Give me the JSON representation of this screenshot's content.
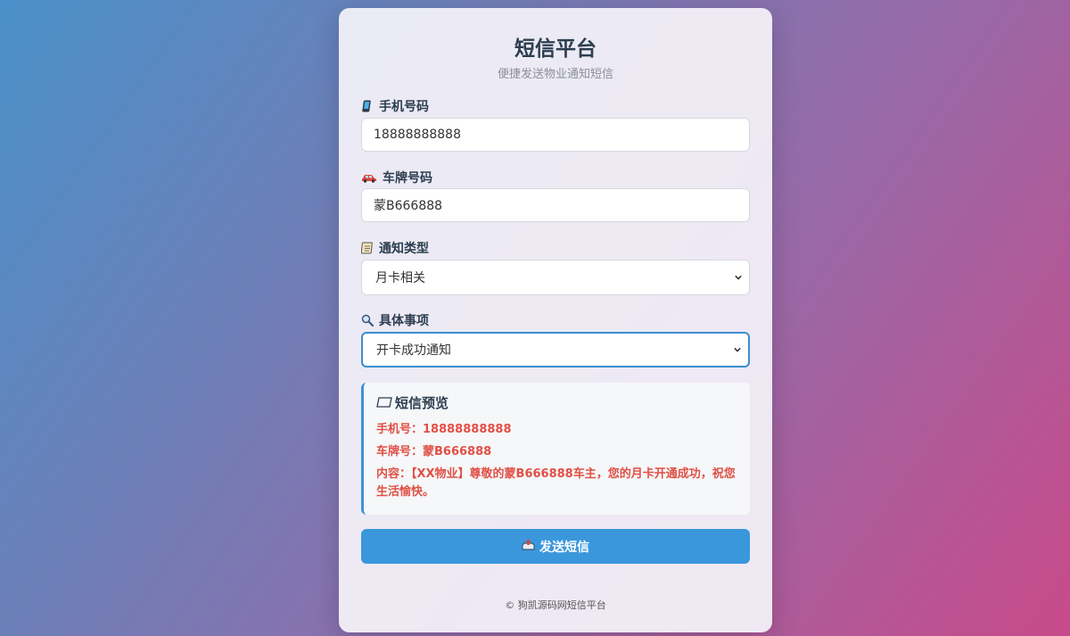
{
  "header": {
    "title": "短信平台",
    "subtitle": "便捷发送物业通知短信"
  },
  "form": {
    "phone": {
      "label": "手机号码",
      "icon": "mobile-phone-icon",
      "value": "18888888888"
    },
    "plate": {
      "label": "车牌号码",
      "icon": "car-icon",
      "value": "蒙B666888"
    },
    "notice_type": {
      "label": "通知类型",
      "icon": "notepad-icon",
      "selected": "月卡相关"
    },
    "item": {
      "label": "具体事项",
      "icon": "magnifier-icon",
      "selected": "开卡成功通知"
    }
  },
  "preview": {
    "title": "短信预览",
    "icon": "message-icon",
    "phone_line": "手机号：18888888888",
    "plate_line": "车牌号：蒙B666888",
    "content_line": "内容：【XX物业】尊敬的蒙B666888车主，您的月卡开通成功，祝您生活愉快。"
  },
  "send_button": {
    "label": "发送短信",
    "icon": "outbox-icon"
  },
  "footer": {
    "text": "© 狗凯源码网短信平台"
  },
  "colors": {
    "accent": "#3a97dc",
    "preview_text": "#e05046",
    "title": "#2c3e50"
  }
}
